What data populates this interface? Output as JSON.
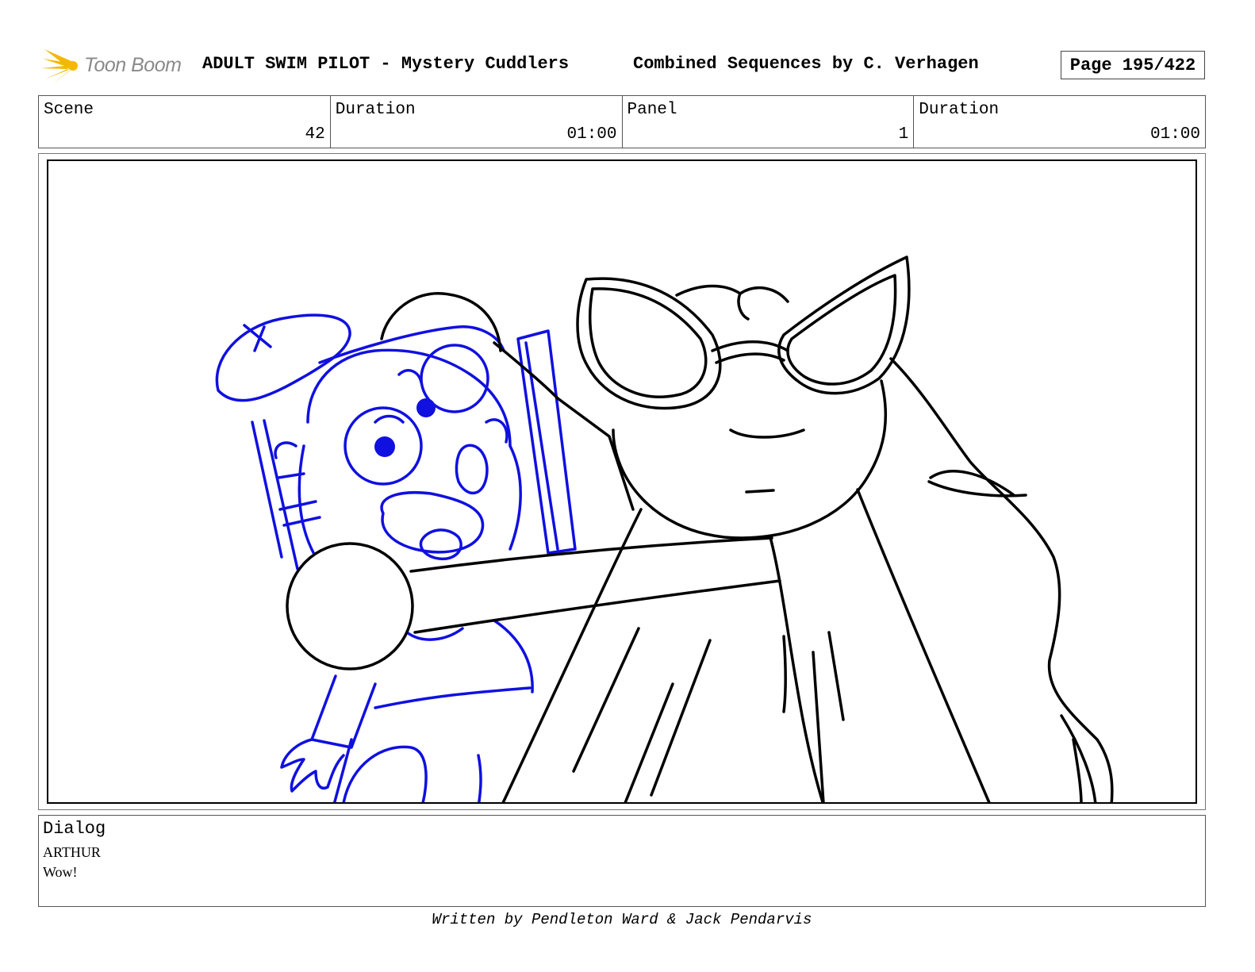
{
  "header": {
    "logo_text": "Toon Boom",
    "project_title": "ADULT SWIM PILOT - Mystery Cuddlers",
    "sequence_info": "Combined Sequences by C. Verhagen",
    "page": "Page 195/422"
  },
  "info": {
    "scene_label": "Scene",
    "scene_value": "42",
    "scene_duration_label": "Duration",
    "scene_duration_value": "01:00",
    "panel_label": "Panel",
    "panel_value": "1",
    "panel_duration_label": "Duration",
    "panel_duration_value": "01:00"
  },
  "dialog": {
    "label": "Dialog",
    "character": "ARTHUR",
    "line": "Wow!"
  },
  "footer": {
    "credit": "Written by Pendleton Ward & Jack Pendarvis"
  },
  "colors": {
    "sketch_blue": "#1010e0",
    "ink_black": "#000000",
    "logo_yellow": "#f5b800",
    "logo_gray": "#8a8a8a"
  }
}
